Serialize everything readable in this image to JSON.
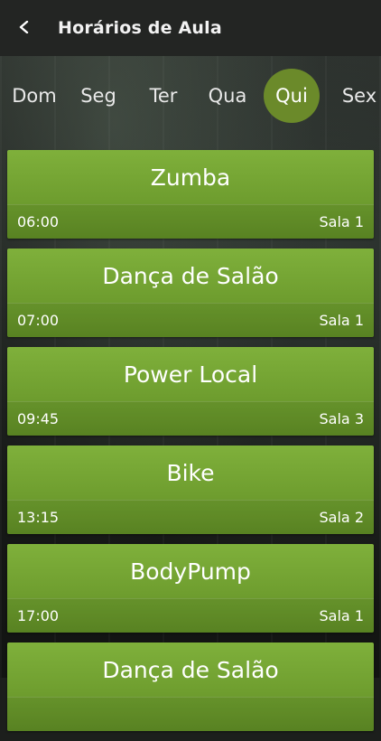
{
  "header": {
    "title": "Horários de Aula",
    "back_icon": "chevron-left-icon"
  },
  "days": [
    {
      "label": "Dom",
      "active": false
    },
    {
      "label": "Seg",
      "active": false
    },
    {
      "label": "Ter",
      "active": false
    },
    {
      "label": "Qua",
      "active": false
    },
    {
      "label": "Qui",
      "active": true
    },
    {
      "label": "Sex",
      "active": false
    }
  ],
  "colors": {
    "accent": "#6b8a2a",
    "card_green": "#75a535",
    "header_bg": "#232523"
  },
  "classes": [
    {
      "name": "Zumba",
      "time": "06:00",
      "room": "Sala 1"
    },
    {
      "name": "Dança de Salão",
      "time": "07:00",
      "room": "Sala 1"
    },
    {
      "name": "Power Local",
      "time": "09:45",
      "room": "Sala 3"
    },
    {
      "name": "Bike",
      "time": "13:15",
      "room": "Sala 2"
    },
    {
      "name": "BodyPump",
      "time": "17:00",
      "room": "Sala 1"
    },
    {
      "name": "Dança de Salão",
      "time": "",
      "room": ""
    }
  ]
}
